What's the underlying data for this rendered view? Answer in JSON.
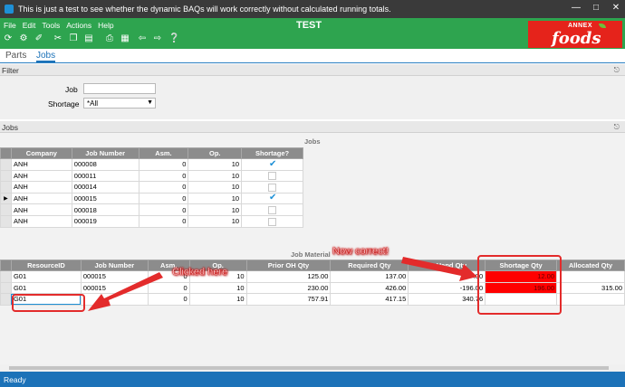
{
  "window": {
    "title": "This is just a test to see whether the dynamic BAQs will work correctly without calculated running totals."
  },
  "menu": [
    "File",
    "Edit",
    "Tools",
    "Actions",
    "Help"
  ],
  "app_title": "TEST",
  "logo": {
    "line1": "ANNEX",
    "line2": "foods"
  },
  "toolbar_icons": [
    "refresh-icon",
    "settings-icon",
    "clear-icon",
    "cut-icon",
    "copy-icon",
    "paste-icon",
    "print-icon",
    "grid-icon",
    "back-icon",
    "forward-icon",
    "help-icon"
  ],
  "tabs": [
    {
      "label": "Parts"
    },
    {
      "label": "Jobs"
    }
  ],
  "filter": {
    "header": "Filter",
    "job_label": "Job",
    "job_value": "",
    "shortage_label": "Shortage",
    "shortage_value": "*All"
  },
  "jobs_panel": {
    "header": "Jobs",
    "caption": "Jobs",
    "columns": [
      "Company",
      "Job Number",
      "Asm.",
      "Op.",
      "Shortage?"
    ],
    "rows": [
      {
        "company": "ANH",
        "job": "000008",
        "asm": "0",
        "op": "10",
        "shortage": true
      },
      {
        "company": "ANH",
        "job": "000011",
        "asm": "0",
        "op": "10",
        "shortage": false
      },
      {
        "company": "ANH",
        "job": "000014",
        "asm": "0",
        "op": "10",
        "shortage": false
      },
      {
        "company": "ANH",
        "job": "000015",
        "asm": "0",
        "op": "10",
        "shortage": true
      },
      {
        "company": "ANH",
        "job": "000018",
        "asm": "0",
        "op": "10",
        "shortage": false
      },
      {
        "company": "ANH",
        "job": "000019",
        "asm": "0",
        "op": "10",
        "shortage": false
      }
    ]
  },
  "materials": {
    "caption": "Job Material",
    "columns": [
      "ResourceID",
      "Job Number",
      "Asm.",
      "Op.",
      "Prior OH Qty",
      "Required Qty",
      "OnHand Qty",
      "Shortage Qty",
      "Allocated Qty"
    ],
    "rows": [
      {
        "resource": "G01",
        "job": "000015",
        "asm": "0",
        "op": "10",
        "prior": "125.00",
        "required": "137.00",
        "onhand": ".00",
        "shortage": "12.00",
        "allocated": ""
      },
      {
        "resource": "G01",
        "job": "000015",
        "asm": "0",
        "op": "10",
        "prior": "230.00",
        "required": "426.00",
        "onhand": "-196.00",
        "shortage": "196.00",
        "allocated": "315.00"
      },
      {
        "resource": "G01",
        "job": "",
        "asm": "0",
        "op": "10",
        "prior": "757.91",
        "required": "417.15",
        "onhand": "340.76",
        "shortage": "",
        "allocated": ""
      }
    ]
  },
  "annotations": {
    "now_correct": "Now correct!",
    "clicked_here": "Clicked here"
  },
  "status": "Ready",
  "colors": {
    "ribbon": "#2ea44f",
    "accent": "#1c72b8",
    "shortage": "#ff0000",
    "annotation": "#e32b2b"
  }
}
